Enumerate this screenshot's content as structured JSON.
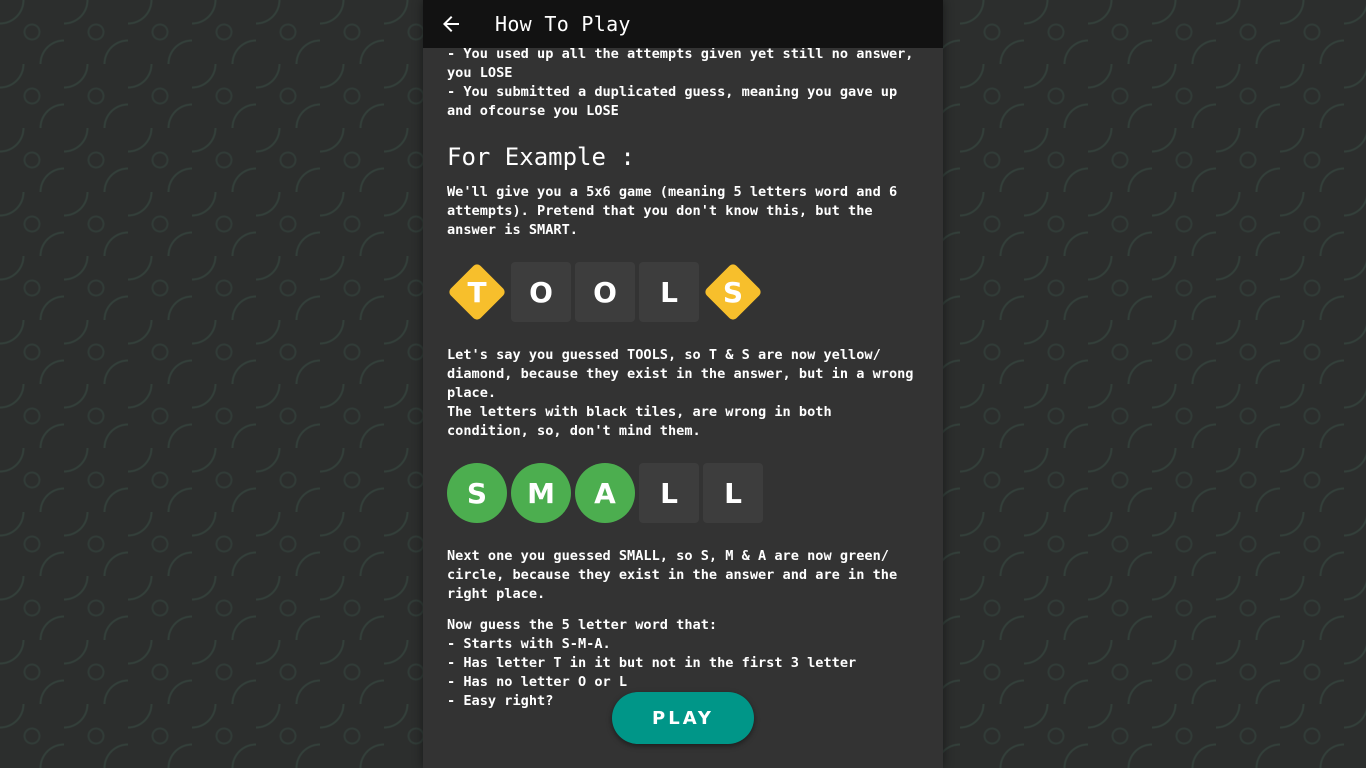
{
  "header": {
    "title": "How To Play",
    "back_icon": "arrow-left-icon"
  },
  "content": {
    "intro_lines": "- You used up all the attempts given yet still no answer, you LOSE\n- You submitted a duplicated guess, meaning you gave up and ofcourse you LOSE",
    "example_heading": "For Example :",
    "example_intro": "We'll give you a 5x6 game (meaning 5 letters word and 6 attempts). Pretend that you don't know this, but the answer is SMART.",
    "row1": [
      {
        "letter": "T",
        "state": "diamond-yellow"
      },
      {
        "letter": "O",
        "state": "absent"
      },
      {
        "letter": "O",
        "state": "absent"
      },
      {
        "letter": "L",
        "state": "absent"
      },
      {
        "letter": "S",
        "state": "diamond-yellow"
      }
    ],
    "row1_explanation": "Let's say you guessed TOOLS, so T & S are now yellow/ diamond, because they exist in the answer, but in a wrong place.\nThe letters with black tiles, are wrong in both condition, so, don't mind them.",
    "row2": [
      {
        "letter": "S",
        "state": "circle-green"
      },
      {
        "letter": "M",
        "state": "circle-green"
      },
      {
        "letter": "A",
        "state": "circle-green"
      },
      {
        "letter": "L",
        "state": "absent"
      },
      {
        "letter": "L",
        "state": "absent"
      }
    ],
    "row2_explanation": "Next one you guessed SMALL, so S, M & A are now green/ circle, because they exist in the answer and are in the right place.",
    "final_hint": "Now guess the 5 letter word that:\n- Starts with S-M-A.\n- Has letter T in it but not in the first 3 letter\n- Has no letter O or L\n- Easy right?"
  },
  "play_button": {
    "label": "PLAY"
  },
  "colors": {
    "yellow": "#f7bf2c",
    "green": "#4cae4f",
    "absent": "#3d3d3d",
    "accent": "#009688",
    "panel": "#333333",
    "topbar": "#121212"
  }
}
